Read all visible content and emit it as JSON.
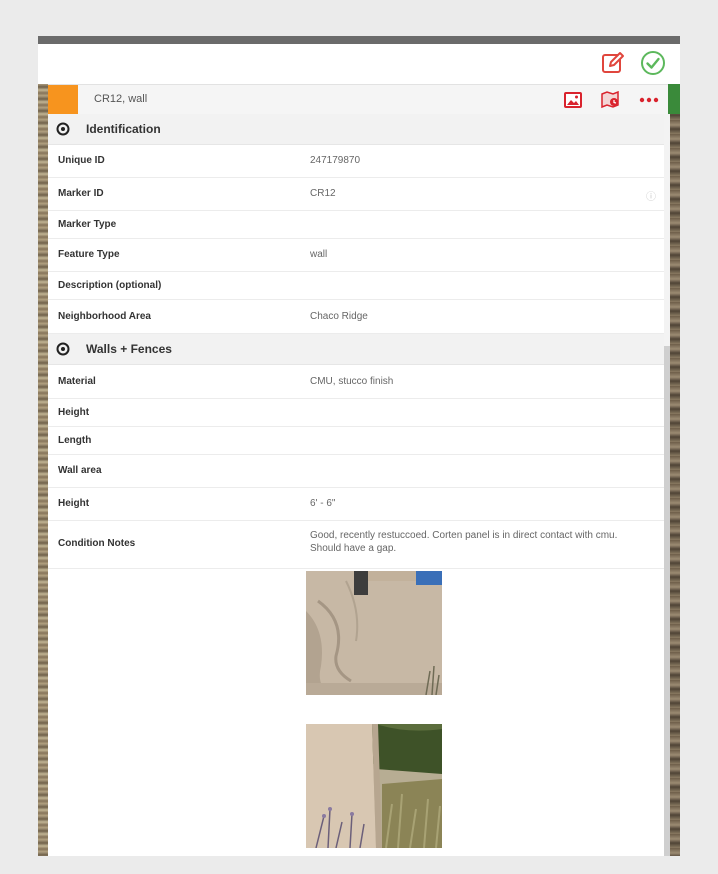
{
  "title": "CR12, wall",
  "identification": {
    "heading": "Identification",
    "rows": [
      {
        "label": "Unique ID",
        "value": "247179870"
      },
      {
        "label": "Marker ID",
        "value": "CR12"
      },
      {
        "label": "Marker Type",
        "value": ""
      },
      {
        "label": "Feature Type",
        "value": "wall"
      },
      {
        "label": "Description (optional)",
        "value": ""
      },
      {
        "label": "Neighborhood Area",
        "value": "Chaco Ridge"
      }
    ]
  },
  "walls": {
    "heading": "Walls + Fences",
    "rows": [
      {
        "label": "Material",
        "value": "CMU, stucco finish"
      },
      {
        "label": "Height",
        "value": ""
      },
      {
        "label": "Length",
        "value": ""
      },
      {
        "label": "Wall area",
        "value": ""
      },
      {
        "label": "Height",
        "value": "6' - 6\""
      },
      {
        "label": "Condition Notes",
        "value": "Good, recently restuccoed. Corten panel is in direct contact with cmu. Should have a gap."
      }
    ]
  },
  "info_symbol": "ⓘ",
  "colors": {
    "accent_orange": "#f7941e",
    "edit_red": "#e0463d",
    "confirm_green": "#5cb85c",
    "more_red": "#d9232d"
  }
}
